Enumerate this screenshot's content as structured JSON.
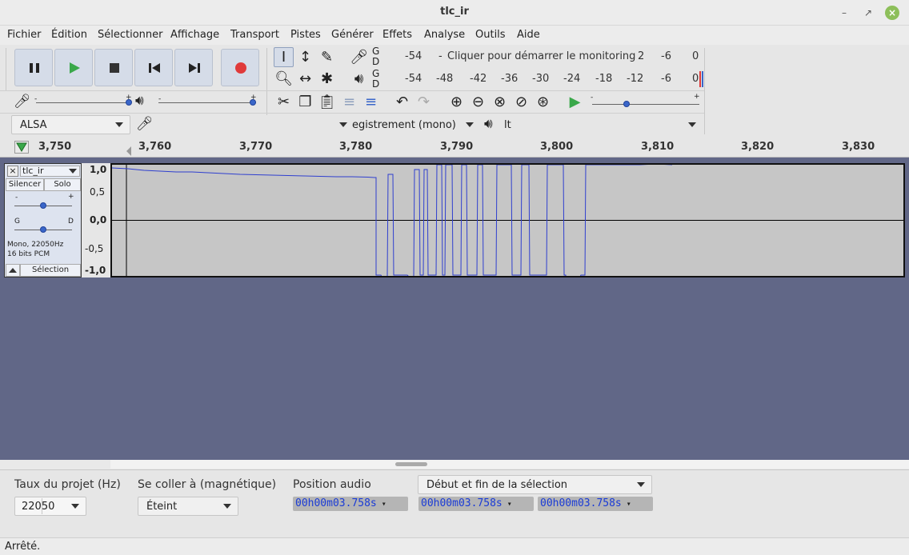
{
  "window": {
    "title": "tlc_ir"
  },
  "menu": [
    "Fichier",
    "Édition",
    "Sélectionner",
    "Affichage",
    "Transport",
    "Pistes",
    "Générer",
    "Effets",
    "Analyse",
    "Outils",
    "Aide"
  ],
  "meters": {
    "rec_channels": [
      "G",
      "D"
    ],
    "play_channels": [
      "G",
      "D"
    ],
    "rec_scale": [
      "-54",
      "2",
      "-6",
      "0"
    ],
    "monitor_text": "Cliquer pour démarrer le monitoring",
    "play_scale": [
      "-54",
      "-48",
      "-42",
      "-36",
      "-30",
      "-24",
      "-18",
      "-12",
      "-6",
      "0"
    ]
  },
  "devices": {
    "host": "ALSA",
    "record_channels": "egistrement (mono)",
    "playback_device": "lt"
  },
  "ruler": {
    "ticks": [
      "3,750",
      "3,760",
      "3,770",
      "3,780",
      "3,790",
      "3,800",
      "3,810",
      "3,820",
      "3,830"
    ]
  },
  "track": {
    "name": "tlc_ir",
    "mute_label": "Silencer",
    "solo_label": "Solo",
    "gain_min": "-",
    "gain_max": "+",
    "pan_left": "G",
    "pan_right": "D",
    "info_line1": "Mono, 22050Hz",
    "info_line2": "16 bits PCM",
    "select_label": "Sélection",
    "scale": [
      "1,0",
      "0,5",
      "0,0",
      "-0,5",
      "-1,0"
    ]
  },
  "bottom": {
    "rate_label": "Taux du projet (Hz)",
    "rate_value": "22050",
    "snap_label": "Se coller à (magnétique)",
    "snap_value": "Éteint",
    "position_label": "Position audio",
    "position_value": "00h00m03.758s",
    "selection_mode": "Début et fin de la sélection",
    "sel_start": "00h00m03.758s",
    "sel_end": "00h00m03.758s"
  },
  "status": "Arrêté.",
  "colors": {
    "accent": "#3a66c9",
    "waveform": "#2f3fcf",
    "track_area": "#616787",
    "record": "#e03a3a",
    "play": "#3aa84a"
  }
}
